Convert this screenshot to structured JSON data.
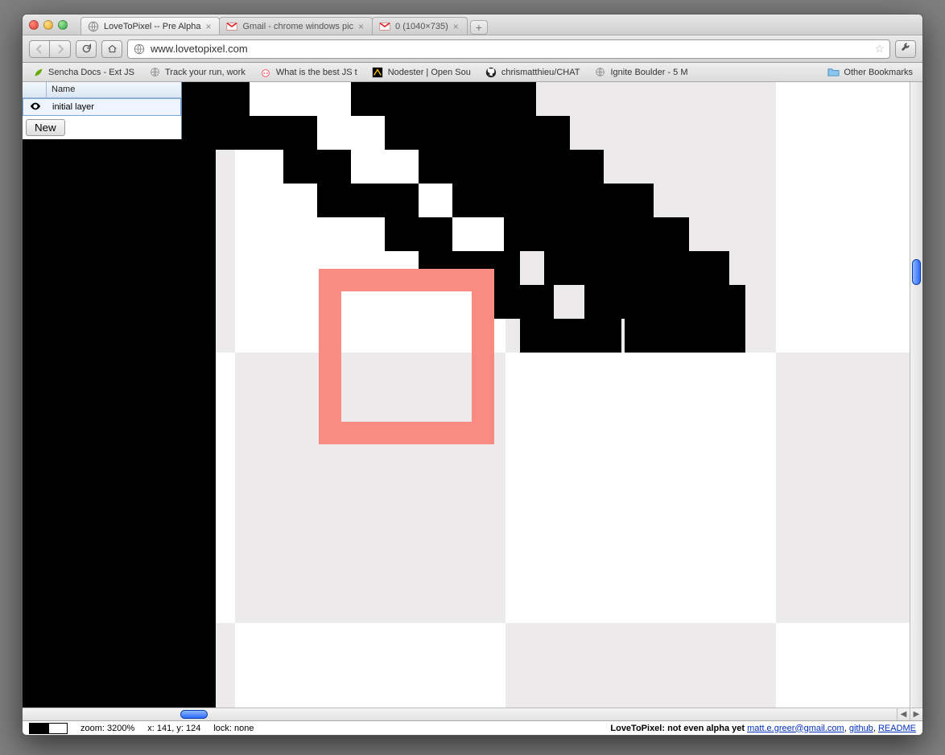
{
  "browser": {
    "tabs": [
      {
        "title": "LoveToPixel -- Pre Alpha",
        "favicon": "globe"
      },
      {
        "title": "Gmail - chrome windows pic",
        "favicon": "gmail"
      },
      {
        "title": "0 (1040×735)",
        "favicon": "gmail"
      }
    ],
    "url": "www.lovetopixel.com",
    "bookmarks": [
      {
        "label": "Sencha Docs - Ext JS",
        "icon": "leaf"
      },
      {
        "label": "Track your run, work",
        "icon": "globe"
      },
      {
        "label": "What is the best JS t",
        "icon": "reddit"
      },
      {
        "label": "Nodester | Open Sou",
        "icon": "node"
      },
      {
        "label": "chrismatthieu/CHAT",
        "icon": "github"
      },
      {
        "label": "Ignite Boulder - 5 M",
        "icon": "globe"
      }
    ],
    "other_bookmarks": "Other Bookmarks"
  },
  "layers_panel": {
    "header_name": "Name",
    "rows": [
      {
        "name": "initial layer",
        "visible": true,
        "selected": true
      }
    ],
    "new_button": "New"
  },
  "status_bar": {
    "zoom_label": "zoom: 3200%",
    "coords": "x: 141, y: 124",
    "lock": "lock: none",
    "app_title": "LoveToPixel: not even alpha yet",
    "email": "matt.e.greer@gmail.com",
    "github": "github",
    "readme": "README"
  },
  "colors": {
    "brush": "#f98b83",
    "transparency_light": "#ffffff",
    "transparency_dark": "#eceaea"
  }
}
